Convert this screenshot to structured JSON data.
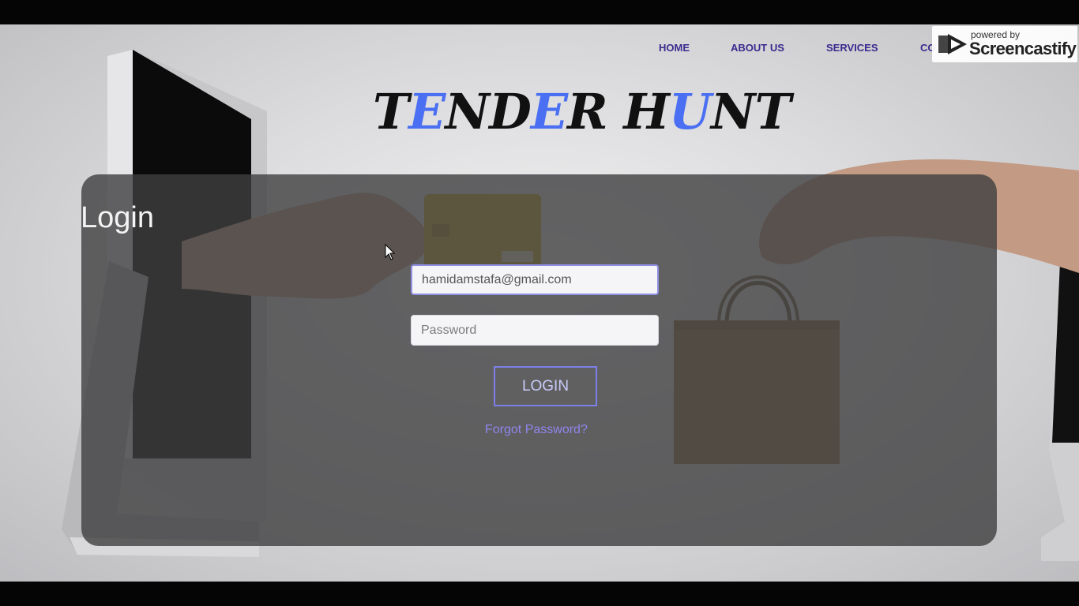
{
  "nav": {
    "home": "HOME",
    "about": "ABOUT US",
    "services": "SERVICES",
    "contact": "CO"
  },
  "logo": {
    "parts": [
      {
        "text": "T",
        "accent": false
      },
      {
        "text": "E",
        "accent": true
      },
      {
        "text": "ND",
        "accent": false
      },
      {
        "text": "E",
        "accent": true
      },
      {
        "text": "R H",
        "accent": false
      },
      {
        "text": "U",
        "accent": true
      },
      {
        "text": "NT",
        "accent": false
      }
    ]
  },
  "login": {
    "title": "Login",
    "email_value": "hamidamstafa@gmail.com",
    "password_placeholder": "Password",
    "button_label": "LOGIN",
    "forgot_label": "Forgot Password?"
  },
  "watermark": {
    "powered": "powered by",
    "brand": "Screencastify"
  },
  "colors": {
    "nav_text": "#3a2a8e",
    "logo_accent": "#4a6ff2",
    "button_border": "#7d7fe8",
    "link": "#8f86ee"
  },
  "icons": {
    "cursor": "mouse-pointer-icon",
    "watermark_logo": "screencastify-logo-icon"
  }
}
